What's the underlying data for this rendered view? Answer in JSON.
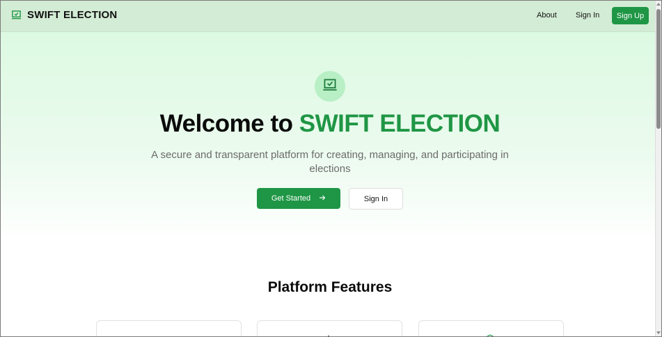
{
  "nav": {
    "brand": "SWIFT ELECTION",
    "brand_icon": "ballot-laptop-icon",
    "links": {
      "about": "About",
      "signin": "Sign In",
      "signup": "Sign Up"
    }
  },
  "hero": {
    "badge_icon": "ballot-laptop-icon",
    "title_prefix": "Welcome to ",
    "title_accent": "SWIFT ELECTION",
    "subtitle": "A secure and transparent platform for creating, managing, and participating in elections",
    "primary_button": "Get Started",
    "primary_button_icon": "arrow-right-icon",
    "secondary_button": "Sign In"
  },
  "features": {
    "title": "Platform Features",
    "cards": [
      {
        "icon": "feature-icon"
      },
      {
        "icon": "feature-icon"
      },
      {
        "icon": "shield-icon"
      }
    ]
  },
  "colors": {
    "accent": "#1f9645",
    "nav_bg": "#d3ecd5",
    "hero_bg": "#dcf9e2",
    "badge_bg": "#b8efc5",
    "subtitle": "#6b6b6b"
  }
}
